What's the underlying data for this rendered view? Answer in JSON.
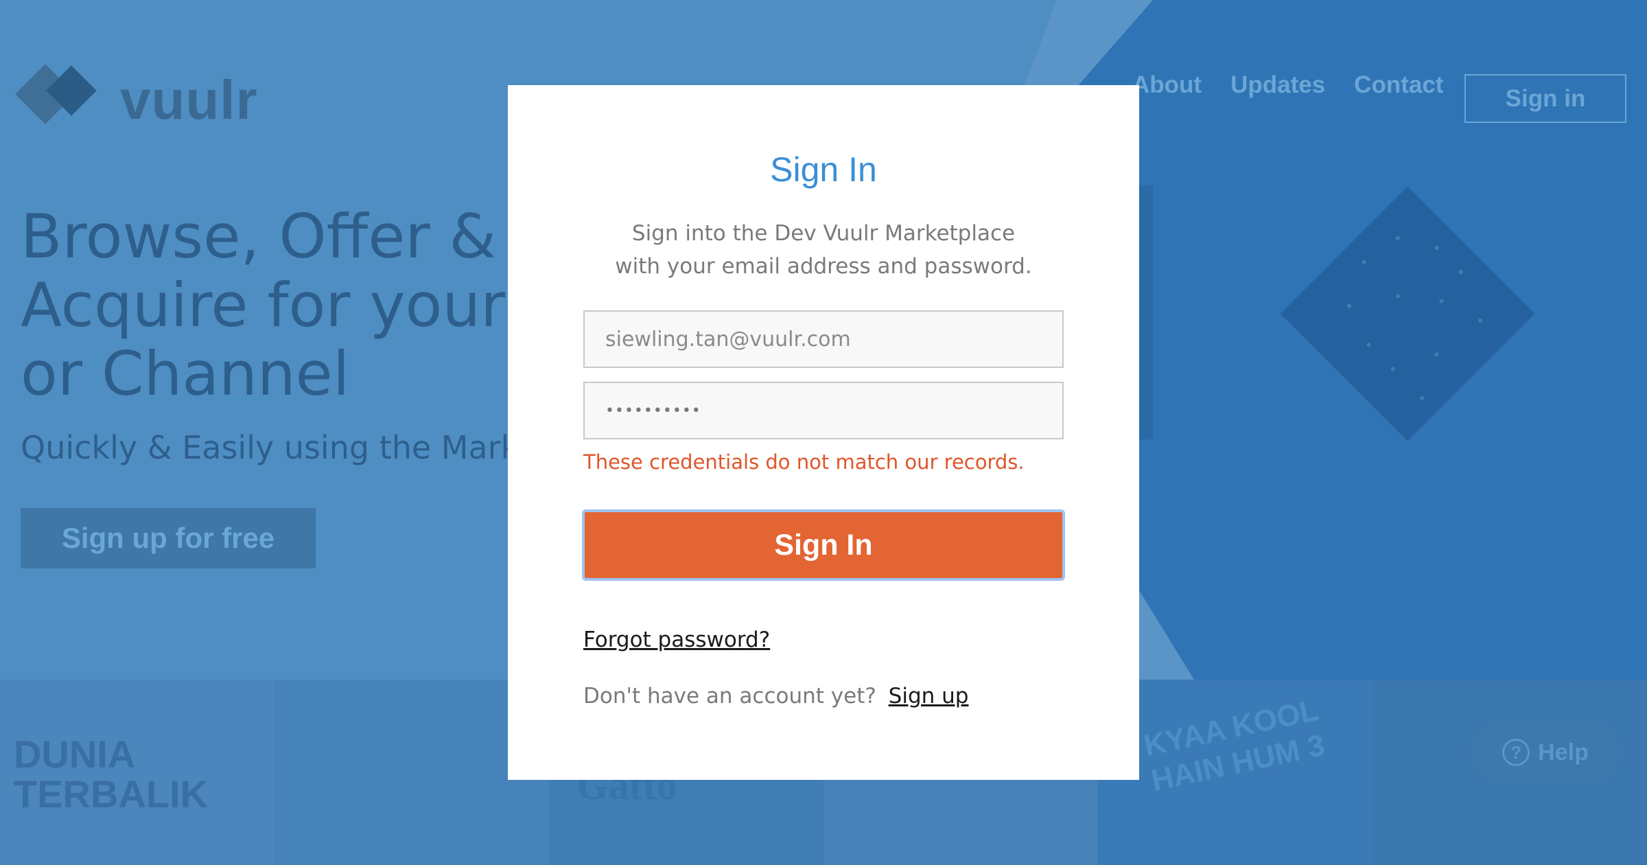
{
  "background": {
    "logo_text": "vuulr",
    "nav": {
      "items": [
        "About",
        "Updates",
        "Contact"
      ],
      "signin_label": "Sign in"
    },
    "hero": {
      "headline_lines": [
        "Browse, Offer &",
        "Acquire for your",
        "or Channel"
      ],
      "subline": "Quickly & Easily using the Marke",
      "signup_label": "Sign up for free"
    },
    "tiles": [
      {
        "name": "Dunia Terbalik",
        "text": "DUNIA TERBALIK"
      },
      {
        "name": "",
        "text": ""
      },
      {
        "name": "Gatto",
        "text": "Gatto"
      },
      {
        "name": "",
        "text": ""
      },
      {
        "name": "Kyaa Kool Hain Hum 3",
        "text": "KYAA KOOL HAIN HUM 3"
      },
      {
        "name": "",
        "text": ""
      }
    ],
    "help_label": "Help",
    "colors": {
      "bg": "#4f8ec3",
      "panel": "#2f74b4",
      "diamond": "#24619f"
    }
  },
  "modal": {
    "title": "Sign In",
    "description_line1": "Sign into the Dev Vuulr Marketplace",
    "description_line2": "with your email address and password.",
    "email_value": "siewling.tan@vuulr.com",
    "password_value": "••••••••••",
    "error": "These credentials do not match our records.",
    "submit_label": "Sign In",
    "forgot_label": "Forgot password?",
    "no_account_text": "Don't have an account yet?",
    "signup_link": "Sign up",
    "colors": {
      "accent": "#3a8fd5",
      "button": "#e36534",
      "error": "#e0562a"
    }
  }
}
